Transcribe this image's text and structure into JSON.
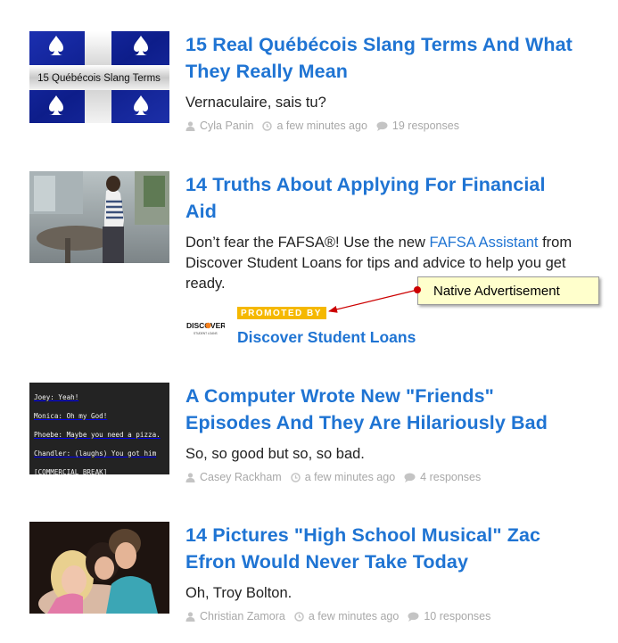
{
  "articles": [
    {
      "thumb_text": "15 Québécois Slang Terms",
      "title": "15 Real Québécois Slang Terms And What They Really Mean",
      "dek": "Vernaculaire, sais tu?",
      "author": "Cyla Panin",
      "time": "a few minutes ago",
      "responses": "19 responses"
    },
    {
      "title": "14 Truths About Applying For Financial Aid",
      "dek_before": "Don’t fear the FAFSA®! Use the new ",
      "dek_link": "FAFSA Assistant",
      "dek_after": " from Discover Student Loans for tips and advice to help you get ready.",
      "promoted_label": "PROMOTED BY",
      "sponsor": "Discover Student Loans",
      "sponsor_logo_text": "DISCOVER",
      "sponsor_logo_sub": "STUDENT LOANS"
    },
    {
      "thumb_lines": [
        "Joey: Yeah!",
        "Monica: Oh my God!",
        "Phoebe: Maybe you need a pizza.",
        "Chandler: (laughs) You got him",
        "[COMMERCIAL BREAK]"
      ],
      "title": "A Computer Wrote New \"Friends\" Episodes And They Are Hilariously Bad",
      "dek": "So, so good but so, so bad.",
      "author": "Casey Rackham",
      "time": "a few minutes ago",
      "responses": "4 responses"
    },
    {
      "title": "14 Pictures \"High School Musical\" Zac Efron Would Never Take Today",
      "dek": "Oh, Troy Bolton.",
      "author": "Christian Zamora",
      "time": "a few minutes ago",
      "responses": "10 responses"
    }
  ],
  "annotation": {
    "label": "Native Advertisement"
  },
  "colors": {
    "link": "#1f74d3",
    "meta": "#a8a8a8",
    "promo_badge": "#f5b800",
    "callout_bg": "#ffffcc",
    "arrow": "#cc0000"
  },
  "icons": {
    "author": "user-icon",
    "time": "clock-icon",
    "responses": "comment-icon"
  }
}
